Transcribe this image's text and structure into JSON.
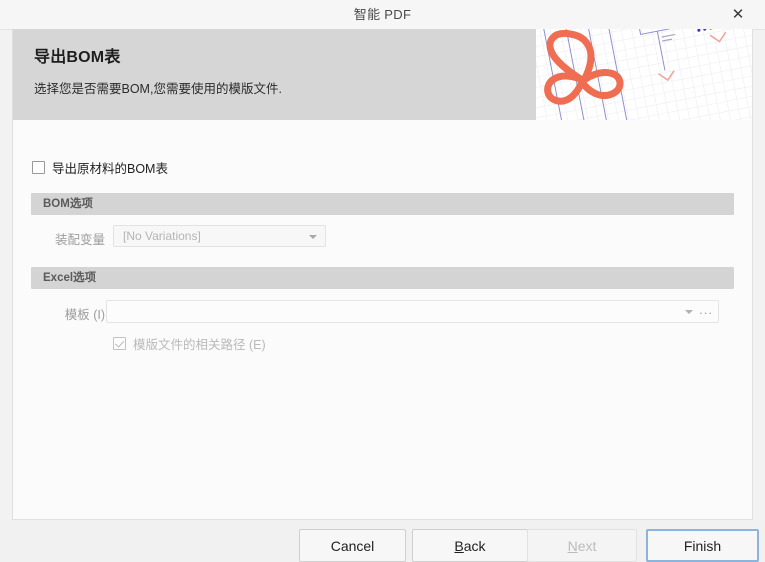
{
  "window": {
    "title": "智能 PDF",
    "close_icon": "close-icon",
    "close_glyph": "✕"
  },
  "banner": {
    "title": "导出BOM表",
    "subtitle": "选择您是否需要BOM,您需要使用的模版文件.",
    "artwork": "pdf-acrobat-schematic-image",
    "background_color": "#d6d6d6",
    "logo_color": "#ef6e52"
  },
  "form": {
    "export_raw_bom_checkbox": {
      "label": "导出原材料的BOM表",
      "checked": false
    },
    "bom_section": {
      "title": "BOM选项",
      "variant_field": {
        "label": "装配变量",
        "value": "[No Variations]",
        "caret_icon": "chevron-down-icon"
      }
    },
    "excel_section": {
      "title": "Excel选项",
      "template_field": {
        "label": "模板 (I)",
        "value": "",
        "caret_icon": "chevron-down-icon",
        "browse_label": "...",
        "browse_icon": "ellipsis-icon"
      },
      "relative_path_checkbox": {
        "label": "模版文件的相关路径 (E)",
        "checked": true,
        "disabled": true
      }
    }
  },
  "footer": {
    "cancel_label": "Cancel",
    "back_label": "Back",
    "back_mnemonic": "B",
    "back_rest": "ack",
    "next_label": "Next",
    "next_mnemonic": "N",
    "next_rest": "ext",
    "finish_label": "Finish",
    "next_disabled": true,
    "focus_color": "#8cb4dd"
  }
}
